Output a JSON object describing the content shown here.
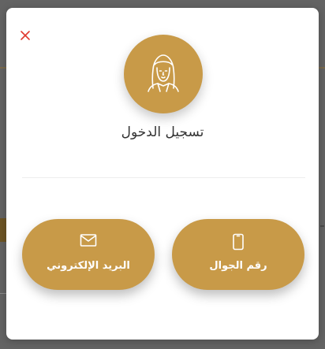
{
  "dialog": {
    "title": "تسجيل الدخول",
    "close_icon": "close-icon",
    "avatar_icon": "woman-hijab-icon",
    "accent_color": "#c89a48",
    "close_color": "#e0382e"
  },
  "options": [
    {
      "label": "البريد الإلكتروني",
      "icon": "envelope-icon"
    },
    {
      "label": "رقم الجوال",
      "icon": "mobile-phone-icon"
    }
  ]
}
